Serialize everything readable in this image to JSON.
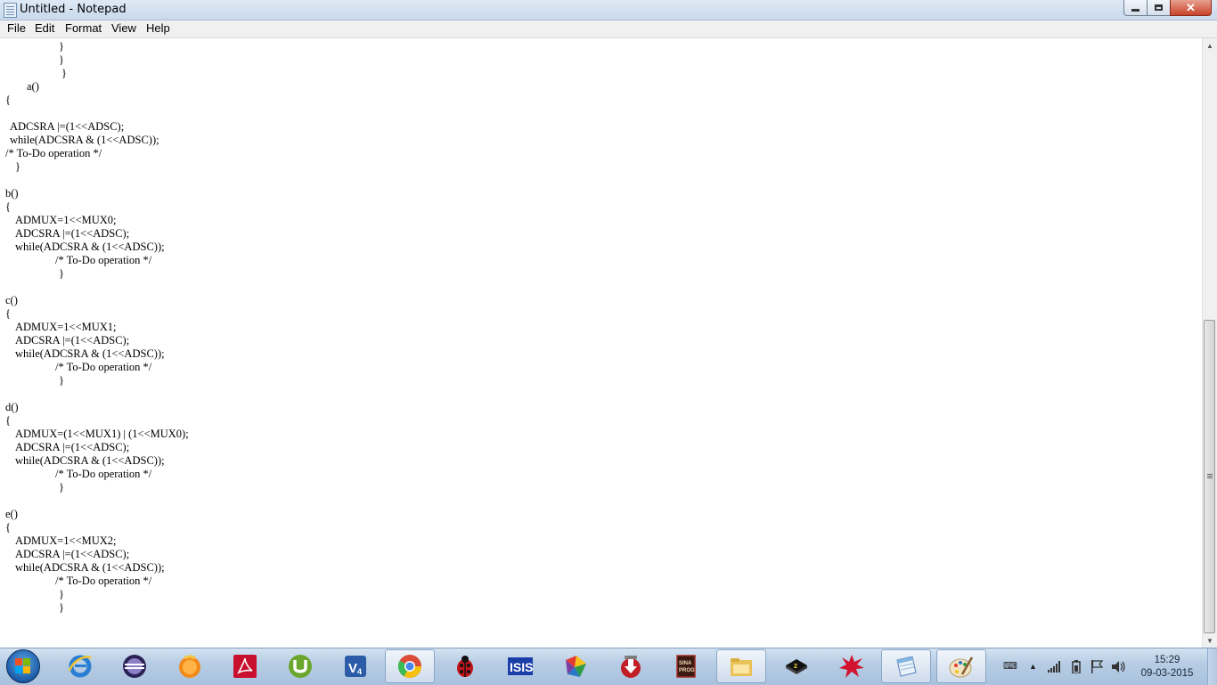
{
  "window": {
    "title": "Untitled - Notepad",
    "buttons": {
      "minimize": "minimize",
      "maximize": "maximize",
      "close": "✕"
    }
  },
  "menu": [
    "File",
    "Edit",
    "Format",
    "View",
    "Help"
  ],
  "editor": {
    "lines": [
      "}",
      "}",
      "}",
      "a()",
      "{",
      "",
      "ADCSRA |=(1<<ADSC);",
      "while(ADCSRA & (1<<ADSC));",
      "/* To-Do operation */",
      "}",
      "",
      "b()",
      "{",
      "ADMUX=1<<MUX0;",
      "ADCSRA |=(1<<ADSC);",
      "while(ADCSRA & (1<<ADSC));",
      "/* To-Do operation */",
      "}",
      "",
      "c()",
      "{",
      "ADMUX=1<<MUX1;",
      "ADCSRA |=(1<<ADSC);",
      "while(ADCSRA & (1<<ADSC));",
      "/* To-Do operation */",
      "}",
      "",
      "d()",
      "{",
      "ADMUX=(1<<MUX1) | (1<<MUX0);",
      "ADCSRA |=(1<<ADSC);",
      "while(ADCSRA & (1<<ADSC));",
      "/* To-Do operation */",
      "}",
      "",
      "e()",
      "{",
      "ADMUX=1<<MUX2;",
      "ADCSRA |=(1<<ADSC);",
      "while(ADCSRA & (1<<ADSC));",
      "/* To-Do operation */",
      "}",
      "}"
    ]
  },
  "taskbar": {
    "apps": [
      {
        "name": "internet-explorer-icon"
      },
      {
        "name": "eclipse-icon"
      },
      {
        "name": "media-player-icon"
      },
      {
        "name": "adobe-reader-icon"
      },
      {
        "name": "utorrent-icon"
      },
      {
        "name": "visual-micro-icon"
      },
      {
        "name": "chrome-icon"
      },
      {
        "name": "ladybug-icon"
      },
      {
        "name": "isis-icon"
      },
      {
        "name": "colorful-app-icon"
      },
      {
        "name": "downloader-icon"
      },
      {
        "name": "sinaprog-icon"
      },
      {
        "name": "file-explorer-icon"
      },
      {
        "name": "chip-icon"
      },
      {
        "name": "burst-icon"
      },
      {
        "name": "notepad-icon"
      },
      {
        "name": "paint-icon"
      }
    ],
    "apps_label_isis": "ISIS",
    "apps_label_sinaprog": "SINA PROG",
    "clock": {
      "time": "15:29",
      "date": "09-03-2015"
    }
  }
}
